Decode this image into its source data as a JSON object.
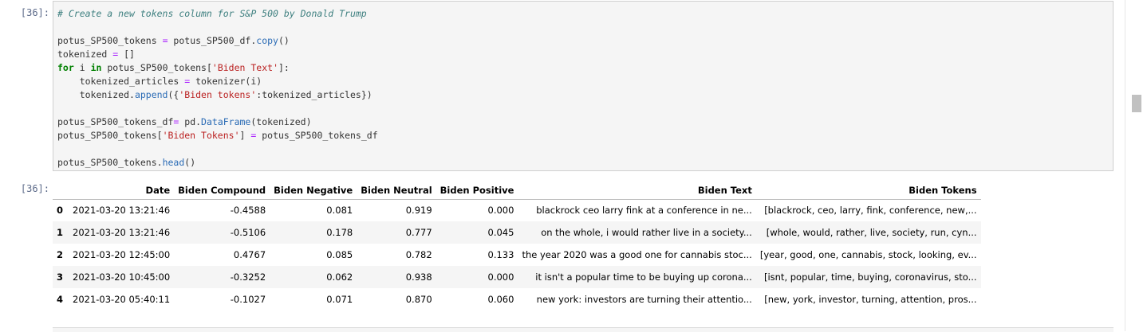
{
  "input_cell": {
    "prompt": "[36]:",
    "code_lines": [
      [
        {
          "t": "# Create a new tokens column for S&P 500 by Donald Trump",
          "c": "cm"
        }
      ],
      [],
      [
        {
          "t": "potus_SP500_tokens "
        },
        {
          "t": "=",
          "c": "op"
        },
        {
          "t": " potus_SP500_df."
        },
        {
          "t": "copy",
          "c": "fn"
        },
        {
          "t": "()"
        }
      ],
      [
        {
          "t": "tokenized "
        },
        {
          "t": "=",
          "c": "op"
        },
        {
          "t": " []"
        }
      ],
      [
        {
          "t": "for",
          "c": "kw"
        },
        {
          "t": " i "
        },
        {
          "t": "in",
          "c": "kw"
        },
        {
          "t": " potus_SP500_tokens["
        },
        {
          "t": "'Biden Text'",
          "c": "st"
        },
        {
          "t": "]:"
        }
      ],
      [
        {
          "t": "    tokenized_articles "
        },
        {
          "t": "=",
          "c": "op"
        },
        {
          "t": " tokenizer(i)"
        }
      ],
      [
        {
          "t": "    tokenized."
        },
        {
          "t": "append",
          "c": "fn"
        },
        {
          "t": "({"
        },
        {
          "t": "'Biden tokens'",
          "c": "st"
        },
        {
          "t": ":tokenized_articles})"
        }
      ],
      [],
      [
        {
          "t": "potus_SP500_tokens_df"
        },
        {
          "t": "=",
          "c": "op"
        },
        {
          "t": " pd."
        },
        {
          "t": "DataFrame",
          "c": "fn"
        },
        {
          "t": "(tokenized)"
        }
      ],
      [
        {
          "t": "potus_SP500_tokens["
        },
        {
          "t": "'Biden Tokens'",
          "c": "st"
        },
        {
          "t": "] "
        },
        {
          "t": "=",
          "c": "op"
        },
        {
          "t": " potus_SP500_tokens_df"
        }
      ],
      [],
      [
        {
          "t": "potus_SP500_tokens."
        },
        {
          "t": "head",
          "c": "fn"
        },
        {
          "t": "()"
        }
      ]
    ]
  },
  "output_cell": {
    "prompt": "[36]:",
    "table": {
      "columns": [
        "",
        "Date",
        "Biden Compound",
        "Biden Negative",
        "Biden Neutral",
        "Biden Positive",
        "Biden Text",
        "Biden Tokens"
      ],
      "rows": [
        [
          "0",
          "2021-03-20 13:21:46",
          "-0.4588",
          "0.081",
          "0.919",
          "0.000",
          "blackrock ceo larry fink at a conference in ne...",
          "[blackrock, ceo, larry, fink, conference, new,..."
        ],
        [
          "1",
          "2021-03-20 13:21:46",
          "-0.5106",
          "0.178",
          "0.777",
          "0.045",
          "on the whole, i would rather live in a society...",
          "[whole, would, rather, live, society, run, cyn..."
        ],
        [
          "2",
          "2021-03-20 12:45:00",
          "0.4767",
          "0.085",
          "0.782",
          "0.133",
          "the year 2020 was a good one for cannabis stoc...",
          "[year, good, one, cannabis, stock, looking, ev..."
        ],
        [
          "3",
          "2021-03-20 10:45:00",
          "-0.3252",
          "0.062",
          "0.938",
          "0.000",
          "it isn't a popular time to be buying up corona...",
          "[isnt, popular, time, buying, coronavirus, sto..."
        ],
        [
          "4",
          "2021-03-20 05:40:11",
          "-0.1027",
          "0.071",
          "0.870",
          "0.060",
          "new york: investors are turning their attentio...",
          "[new, york, investor, turning, attention, pros..."
        ]
      ]
    }
  }
}
